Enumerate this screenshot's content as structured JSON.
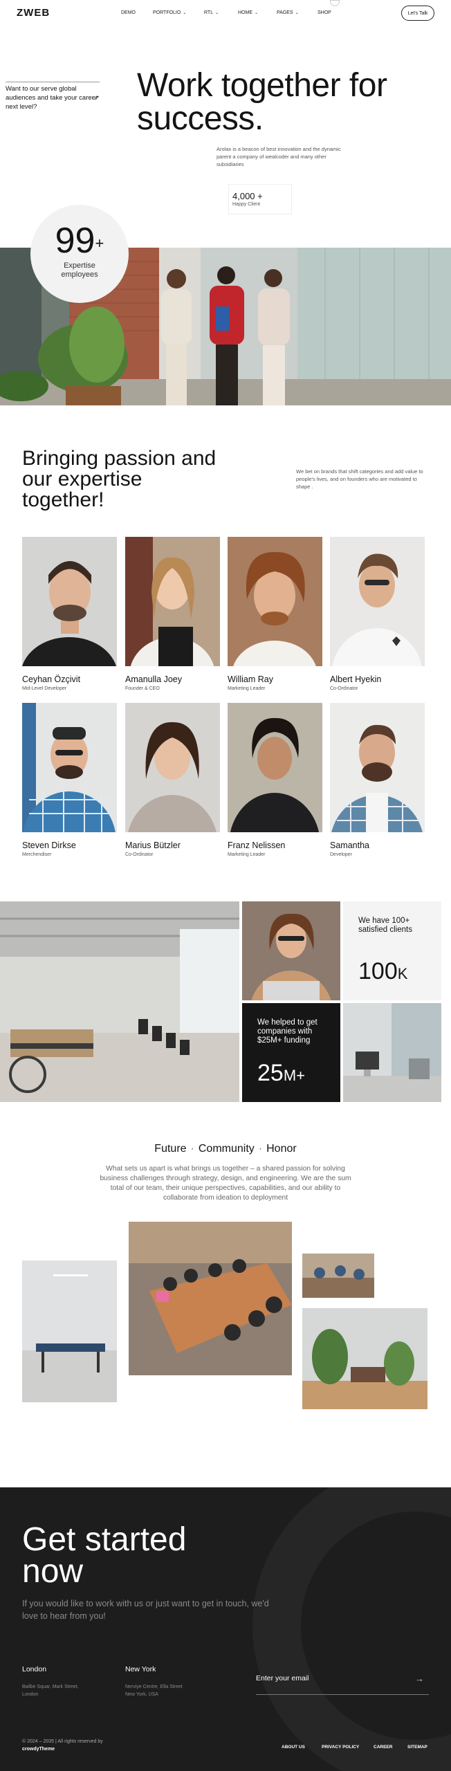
{
  "header": {
    "logo": "ZWEB",
    "nav": [
      {
        "label": "DEMO",
        "chevron": false
      },
      {
        "label": "PORTFOLIO",
        "chevron": true
      },
      {
        "label": "RTL",
        "chevron": true
      },
      {
        "label": "HOME",
        "chevron": true
      },
      {
        "label": "PAGES",
        "chevron": true
      },
      {
        "label": "SHOP",
        "chevron": false
      }
    ],
    "cta": "Let's Talk"
  },
  "hero": {
    "serve_text": "Want to our serve global audiences and take your career next level?",
    "serve_arrow": "↗",
    "title": "Work together for success.",
    "subtitle": "Arolax is a beacon of best innovation and the dynamic parent a company of wealcoder and many other subsidiaries",
    "happy_value": "4,000 +",
    "happy_label": "Happy Client",
    "expertise_value": "99",
    "expertise_plus": "+",
    "expertise_label": "Expertise employees"
  },
  "team": {
    "title": "Bringing passion and our expertise together!",
    "subtitle": "We bet on brands that shift categories and add value to people's lives, and on founders who are motivated to shape .",
    "members": [
      {
        "name": "Ceyhan Özçivit",
        "role": "Mid-Level Developer"
      },
      {
        "name": "Amanulla Joey",
        "role": "Founder & CEO"
      },
      {
        "name": "William Ray",
        "role": "Marketing Leader"
      },
      {
        "name": "Albert Hyekin",
        "role": "Co-Ordinator"
      },
      {
        "name": "Steven Dirkse",
        "role": "Merchendiser"
      },
      {
        "name": "Marius Bützler",
        "role": "Co-Ordinator"
      },
      {
        "name": "Franz Nelissen",
        "role": "Marketing Leader"
      },
      {
        "name": "Samantha",
        "role": "Developer"
      }
    ]
  },
  "stats": {
    "clients_text": "We have 100+ satisfied clients",
    "clients_value": "100",
    "clients_unit": "K",
    "funding_text": "We helped to get companies with $25M+ funding",
    "funding_value": "25",
    "funding_unit": "M+"
  },
  "values": {
    "words": [
      "Future",
      "Community",
      "Honor"
    ],
    "separator": "·",
    "paragraph": "What sets us apart is what brings us together – a shared passion for solving business challenges through strategy, design, and engineering. We are the sum total of our team, their unique perspectives, capabilities, and our ability to collaborate from ideation to deployment"
  },
  "footer": {
    "title": "Get started now",
    "paragraph": "If you would like to work with us or just want to get in touch, we'd love to hear from you!",
    "offices": [
      {
        "city": "London",
        "address": "Bailbe Squar, Mark Street, London"
      },
      {
        "city": "New York",
        "address": "Nerviye Centre, Ella Street New York, USA"
      }
    ],
    "email_placeholder": "Enter your email",
    "email_arrow": "→",
    "copyright": "© 2024 – 2035 | All rights reserved by",
    "brand": "crowdyTheme",
    "links": [
      "ABOUT US",
      "PRIVACY POLICY",
      "CAREER",
      "SITEMAP"
    ]
  },
  "colors": {
    "dark": "#1d1d1d",
    "text": "#141414",
    "muted": "#555555",
    "red_jacket": "#c0262c"
  }
}
